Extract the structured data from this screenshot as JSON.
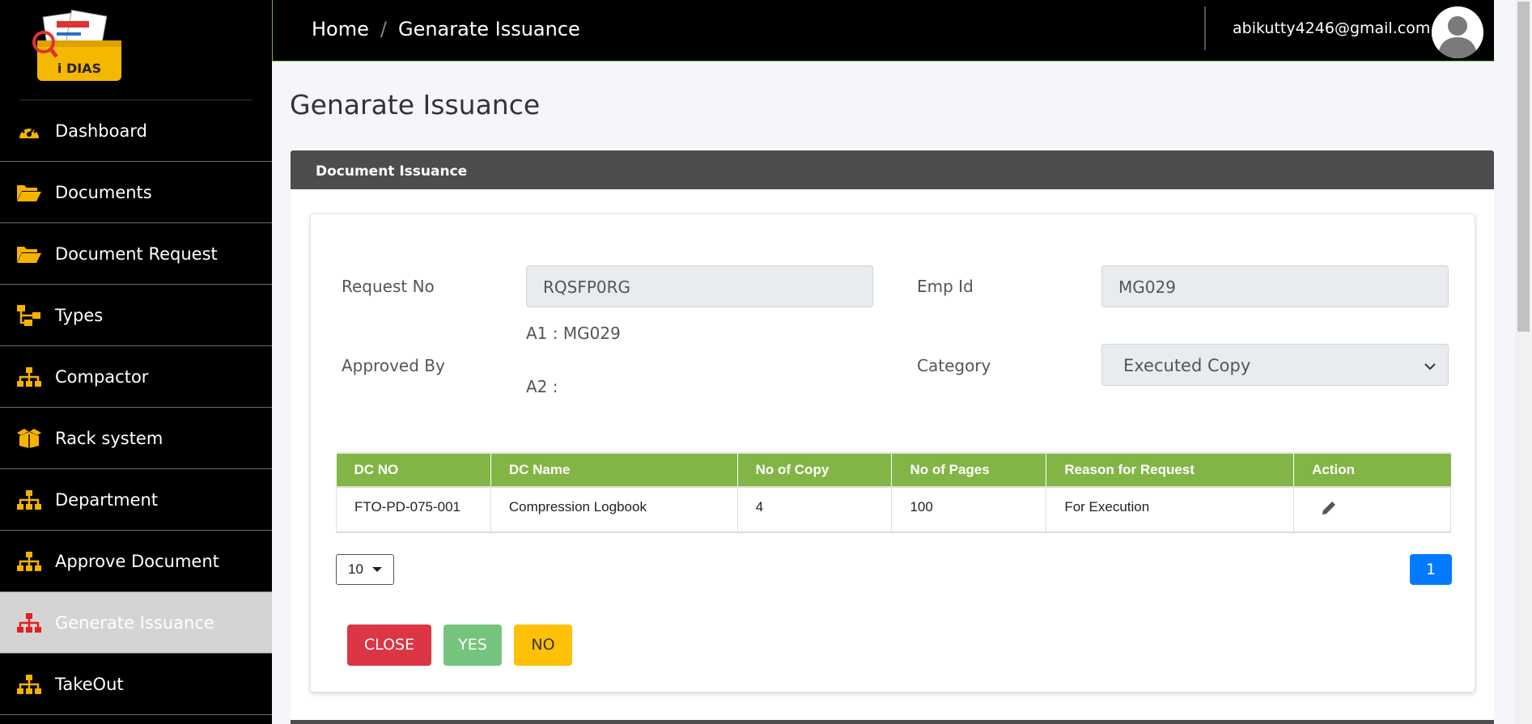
{
  "app": {
    "logo_text": "i DIAS"
  },
  "sidebar": {
    "items": [
      {
        "label": "Dashboard",
        "icon": "dashboard-gauge-icon"
      },
      {
        "label": "Documents",
        "icon": "folder-open-icon"
      },
      {
        "label": "Document Request",
        "icon": "folder-open-icon"
      },
      {
        "label": "Types",
        "icon": "hierarchy-icon"
      },
      {
        "label": "Compactor",
        "icon": "sitemap-icon"
      },
      {
        "label": "Rack system",
        "icon": "box-open-icon"
      },
      {
        "label": "Department",
        "icon": "sitemap-icon"
      },
      {
        "label": "Approve Document",
        "icon": "sitemap-icon"
      },
      {
        "label": "Generate Issuance",
        "icon": "sitemap-icon",
        "active": true
      },
      {
        "label": "TakeOut",
        "icon": "sitemap-icon"
      }
    ]
  },
  "topbar": {
    "breadcrumb_home": "Home",
    "breadcrumb_sep": "/",
    "breadcrumb_current": "Genarate Issuance",
    "user_email": "abikutty4246@gmail.com"
  },
  "page": {
    "title": "Genarate Issuance"
  },
  "panel": {
    "heading": "Document Issuance"
  },
  "form": {
    "request_no_label": "Request No",
    "request_no_value": "RQSFP0RG",
    "emp_id_label": "Emp Id",
    "emp_id_value": "MG029",
    "approved_by_label": "Approved By",
    "approver_a1": "A1 : MG029",
    "approver_a2": "A2 :",
    "category_label": "Category",
    "category_value": "Executed Copy"
  },
  "table": {
    "headers": [
      "DC NO",
      "DC Name",
      "No of Copy",
      "No of Pages",
      "Reason for Request",
      "Action"
    ],
    "rows": [
      [
        "FTO-PD-075-001",
        "Compression Logbook",
        "4",
        "100",
        "For Execution"
      ]
    ]
  },
  "pagination": {
    "page_size": "10",
    "current_page": "1"
  },
  "buttons": {
    "close": "CLOSE",
    "yes": "YES",
    "no": "NO"
  },
  "colors": {
    "sidebar_bg": "#000000",
    "icon_accent": "#f5b300",
    "active_icon": "#e02020",
    "table_header": "#82b545",
    "panel_header": "#4d4d4d",
    "close_btn": "#dc3545",
    "yes_btn": "#75c47e",
    "no_btn": "#ffc107",
    "page_btn": "#007bff"
  }
}
